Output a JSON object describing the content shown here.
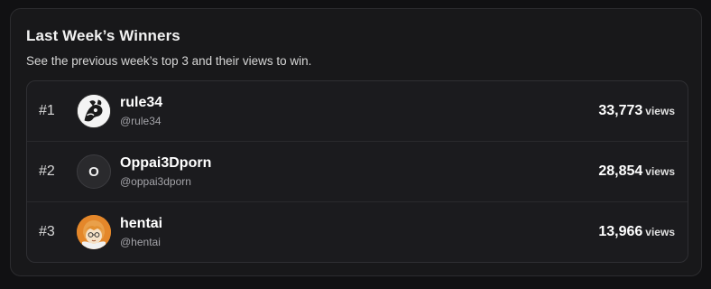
{
  "header": {
    "title": "Last Week’s Winners",
    "subtitle": "See the previous week’s top 3 and their views to win."
  },
  "winners": [
    {
      "rank": "#1",
      "name": "rule34",
      "handle": "@rule34",
      "views": "33,773",
      "views_unit": "views",
      "avatar_icon": "rule34-logo-icon"
    },
    {
      "rank": "#2",
      "name": "Oppai3Dporn",
      "handle": "@oppai3dporn",
      "views": "28,854",
      "views_unit": "views",
      "avatar_letter": "O",
      "avatar_icon": "letter-avatar-icon"
    },
    {
      "rank": "#3",
      "name": "hentai",
      "handle": "@hentai",
      "views": "13,966",
      "views_unit": "views",
      "avatar_icon": "anime-character-icon"
    }
  ],
  "colors": {
    "background": "#111113",
    "card": "#18181a",
    "list": "#1b1b1e",
    "avatar3": "#e4872a"
  }
}
